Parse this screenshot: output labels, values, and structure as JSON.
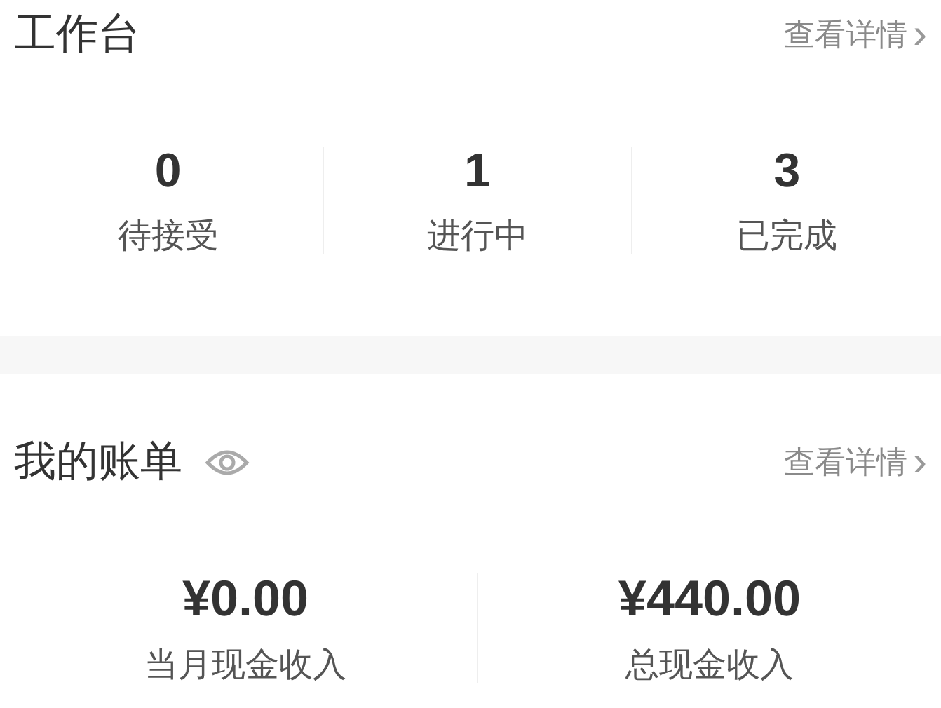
{
  "workbench": {
    "title": "工作台",
    "link": "查看详情",
    "link_arrow": "›",
    "stats": [
      {
        "value": "0",
        "label": "待接受"
      },
      {
        "value": "1",
        "label": "进行中"
      },
      {
        "value": "3",
        "label": "已完成"
      }
    ]
  },
  "bill": {
    "title": "我的账单",
    "link": "查看详情",
    "link_arrow": "›",
    "stats": [
      {
        "value": "¥0.00",
        "label": "当月现金收入"
      },
      {
        "value": "¥440.00",
        "label": "总现金收入"
      }
    ]
  }
}
